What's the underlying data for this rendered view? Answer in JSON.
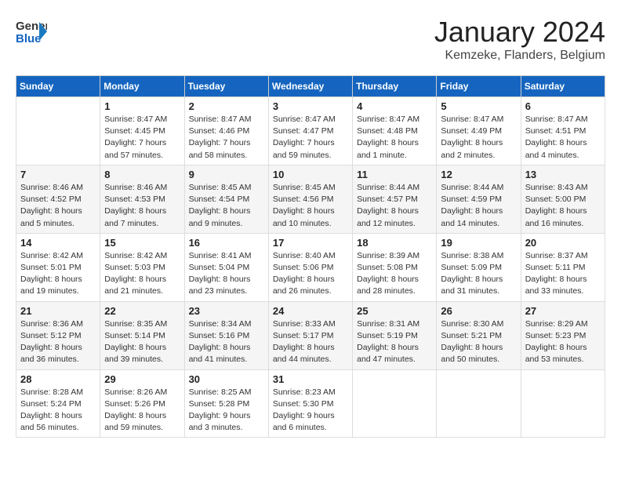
{
  "header": {
    "logo_general": "General",
    "logo_blue": "Blue",
    "title": "January 2024",
    "subtitle": "Kemzeke, Flanders, Belgium"
  },
  "columns": [
    "Sunday",
    "Monday",
    "Tuesday",
    "Wednesday",
    "Thursday",
    "Friday",
    "Saturday"
  ],
  "weeks": [
    [
      {
        "day": "",
        "lines": []
      },
      {
        "day": "1",
        "lines": [
          "Sunrise: 8:47 AM",
          "Sunset: 4:45 PM",
          "Daylight: 7 hours",
          "and 57 minutes."
        ]
      },
      {
        "day": "2",
        "lines": [
          "Sunrise: 8:47 AM",
          "Sunset: 4:46 PM",
          "Daylight: 7 hours",
          "and 58 minutes."
        ]
      },
      {
        "day": "3",
        "lines": [
          "Sunrise: 8:47 AM",
          "Sunset: 4:47 PM",
          "Daylight: 7 hours",
          "and 59 minutes."
        ]
      },
      {
        "day": "4",
        "lines": [
          "Sunrise: 8:47 AM",
          "Sunset: 4:48 PM",
          "Daylight: 8 hours",
          "and 1 minute."
        ]
      },
      {
        "day": "5",
        "lines": [
          "Sunrise: 8:47 AM",
          "Sunset: 4:49 PM",
          "Daylight: 8 hours",
          "and 2 minutes."
        ]
      },
      {
        "day": "6",
        "lines": [
          "Sunrise: 8:47 AM",
          "Sunset: 4:51 PM",
          "Daylight: 8 hours",
          "and 4 minutes."
        ]
      }
    ],
    [
      {
        "day": "7",
        "lines": [
          "Sunrise: 8:46 AM",
          "Sunset: 4:52 PM",
          "Daylight: 8 hours",
          "and 5 minutes."
        ]
      },
      {
        "day": "8",
        "lines": [
          "Sunrise: 8:46 AM",
          "Sunset: 4:53 PM",
          "Daylight: 8 hours",
          "and 7 minutes."
        ]
      },
      {
        "day": "9",
        "lines": [
          "Sunrise: 8:45 AM",
          "Sunset: 4:54 PM",
          "Daylight: 8 hours",
          "and 9 minutes."
        ]
      },
      {
        "day": "10",
        "lines": [
          "Sunrise: 8:45 AM",
          "Sunset: 4:56 PM",
          "Daylight: 8 hours",
          "and 10 minutes."
        ]
      },
      {
        "day": "11",
        "lines": [
          "Sunrise: 8:44 AM",
          "Sunset: 4:57 PM",
          "Daylight: 8 hours",
          "and 12 minutes."
        ]
      },
      {
        "day": "12",
        "lines": [
          "Sunrise: 8:44 AM",
          "Sunset: 4:59 PM",
          "Daylight: 8 hours",
          "and 14 minutes."
        ]
      },
      {
        "day": "13",
        "lines": [
          "Sunrise: 8:43 AM",
          "Sunset: 5:00 PM",
          "Daylight: 8 hours",
          "and 16 minutes."
        ]
      }
    ],
    [
      {
        "day": "14",
        "lines": [
          "Sunrise: 8:42 AM",
          "Sunset: 5:01 PM",
          "Daylight: 8 hours",
          "and 19 minutes."
        ]
      },
      {
        "day": "15",
        "lines": [
          "Sunrise: 8:42 AM",
          "Sunset: 5:03 PM",
          "Daylight: 8 hours",
          "and 21 minutes."
        ]
      },
      {
        "day": "16",
        "lines": [
          "Sunrise: 8:41 AM",
          "Sunset: 5:04 PM",
          "Daylight: 8 hours",
          "and 23 minutes."
        ]
      },
      {
        "day": "17",
        "lines": [
          "Sunrise: 8:40 AM",
          "Sunset: 5:06 PM",
          "Daylight: 8 hours",
          "and 26 minutes."
        ]
      },
      {
        "day": "18",
        "lines": [
          "Sunrise: 8:39 AM",
          "Sunset: 5:08 PM",
          "Daylight: 8 hours",
          "and 28 minutes."
        ]
      },
      {
        "day": "19",
        "lines": [
          "Sunrise: 8:38 AM",
          "Sunset: 5:09 PM",
          "Daylight: 8 hours",
          "and 31 minutes."
        ]
      },
      {
        "day": "20",
        "lines": [
          "Sunrise: 8:37 AM",
          "Sunset: 5:11 PM",
          "Daylight: 8 hours",
          "and 33 minutes."
        ]
      }
    ],
    [
      {
        "day": "21",
        "lines": [
          "Sunrise: 8:36 AM",
          "Sunset: 5:12 PM",
          "Daylight: 8 hours",
          "and 36 minutes."
        ]
      },
      {
        "day": "22",
        "lines": [
          "Sunrise: 8:35 AM",
          "Sunset: 5:14 PM",
          "Daylight: 8 hours",
          "and 39 minutes."
        ]
      },
      {
        "day": "23",
        "lines": [
          "Sunrise: 8:34 AM",
          "Sunset: 5:16 PM",
          "Daylight: 8 hours",
          "and 41 minutes."
        ]
      },
      {
        "day": "24",
        "lines": [
          "Sunrise: 8:33 AM",
          "Sunset: 5:17 PM",
          "Daylight: 8 hours",
          "and 44 minutes."
        ]
      },
      {
        "day": "25",
        "lines": [
          "Sunrise: 8:31 AM",
          "Sunset: 5:19 PM",
          "Daylight: 8 hours",
          "and 47 minutes."
        ]
      },
      {
        "day": "26",
        "lines": [
          "Sunrise: 8:30 AM",
          "Sunset: 5:21 PM",
          "Daylight: 8 hours",
          "and 50 minutes."
        ]
      },
      {
        "day": "27",
        "lines": [
          "Sunrise: 8:29 AM",
          "Sunset: 5:23 PM",
          "Daylight: 8 hours",
          "and 53 minutes."
        ]
      }
    ],
    [
      {
        "day": "28",
        "lines": [
          "Sunrise: 8:28 AM",
          "Sunset: 5:24 PM",
          "Daylight: 8 hours",
          "and 56 minutes."
        ]
      },
      {
        "day": "29",
        "lines": [
          "Sunrise: 8:26 AM",
          "Sunset: 5:26 PM",
          "Daylight: 8 hours",
          "and 59 minutes."
        ]
      },
      {
        "day": "30",
        "lines": [
          "Sunrise: 8:25 AM",
          "Sunset: 5:28 PM",
          "Daylight: 9 hours",
          "and 3 minutes."
        ]
      },
      {
        "day": "31",
        "lines": [
          "Sunrise: 8:23 AM",
          "Sunset: 5:30 PM",
          "Daylight: 9 hours",
          "and 6 minutes."
        ]
      },
      {
        "day": "",
        "lines": []
      },
      {
        "day": "",
        "lines": []
      },
      {
        "day": "",
        "lines": []
      }
    ]
  ]
}
